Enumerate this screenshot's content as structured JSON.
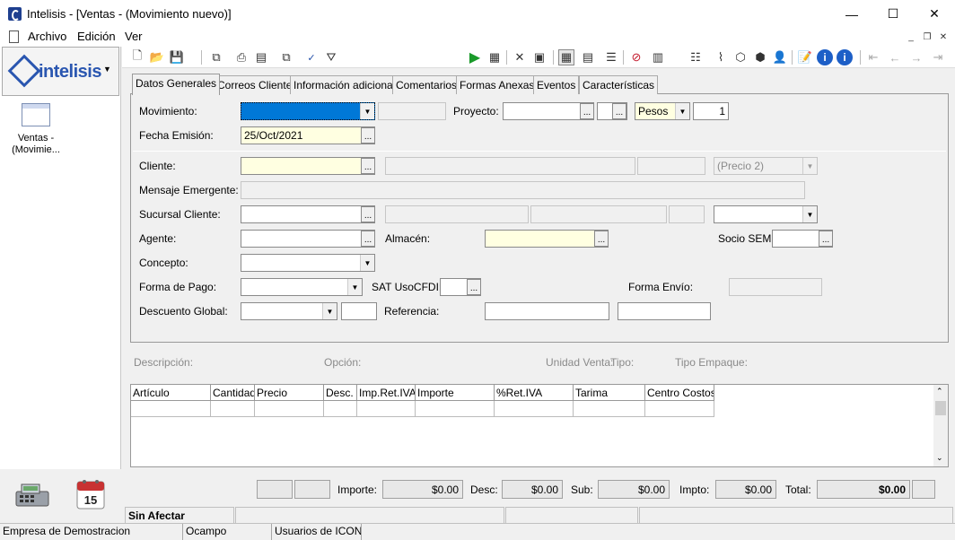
{
  "window": {
    "title": "Intelisis - [Ventas - (Movimiento nuevo)]",
    "minimize_glyph": "—",
    "maximize_glyph": "☐",
    "close_glyph": "✕"
  },
  "menu": {
    "items": [
      {
        "label": "Archivo"
      },
      {
        "label": "Edición"
      },
      {
        "label": "Ver"
      }
    ]
  },
  "nav": {
    "logo_text": "intelisis",
    "logo_arrow": "▼",
    "items": [
      {
        "label": "Ventas - (Movimie..."
      }
    ]
  },
  "toolbar": {
    "icons": [
      "new-icon",
      "open-icon",
      "save-icon",
      "copy-icon",
      "print-icon",
      "preview-icon",
      "duplicate-icon",
      "spellcheck-icon",
      "filter-icon",
      "run-icon",
      "calculator-icon",
      "cancel-icon",
      "report-icon",
      "grid-view-icon",
      "form-view-icon",
      "list-view-icon",
      "disable-icon",
      "barcode-icon",
      "list-icon",
      "attach-icon",
      "box-icon",
      "boxes-icon",
      "user-icon",
      "notes-icon",
      "info-icon",
      "info2-icon",
      "first-icon",
      "prev-icon",
      "next-icon",
      "last-icon"
    ]
  },
  "tabs": [
    {
      "label": "Datos Generales"
    },
    {
      "label": "Correos Cliente"
    },
    {
      "label": "Información adicional"
    },
    {
      "label": "Comentarios"
    },
    {
      "label": "Formas Anexas"
    },
    {
      "label": "Eventos"
    },
    {
      "label": "Características"
    }
  ],
  "form": {
    "movimiento_label": "Movimiento:",
    "movimiento_value": "",
    "proyecto_label": "Proyecto:",
    "moneda_value": "Pesos",
    "tipo_cambio_value": "1",
    "fecha_label": "Fecha Emisión:",
    "fecha_value": "25/Oct/2021",
    "cliente_label": "Cliente:",
    "precio_value": "(Precio 2)",
    "mensaje_label": "Mensaje Emergente:",
    "sucursal_label": "Sucursal Cliente:",
    "agente_label": "Agente:",
    "almacen_label": "Almacén:",
    "socio_label": "Socio SEM:",
    "concepto_label": "Concepto:",
    "forma_pago_label": "Forma de Pago:",
    "sat_label": "SAT UsoCFDI:",
    "forma_envio_label": "Forma Envío:",
    "descuento_label": "Descuento  Global:",
    "referencia_label": "Referencia:"
  },
  "details": {
    "descripcion": "Descripción:",
    "opcion": "Opción:",
    "unidad": "Unidad Venta:",
    "tipo": "Tipo:",
    "empaque": "Tipo Empaque:"
  },
  "grid": {
    "columns": [
      "Artículo",
      "Cantidad",
      "Precio",
      "Desc.",
      "Imp.Ret.IVA",
      "Importe",
      "%Ret.IVA",
      "Tarima",
      "Centro Costos"
    ]
  },
  "totals": {
    "importe_label": "Importe:",
    "importe_value": "$0.00",
    "desc_label": "Desc:",
    "desc_value": "$0.00",
    "sub_label": "Sub:",
    "sub_value": "$0.00",
    "impto_label": "Impto:",
    "impto_value": "$0.00",
    "total_label": "Total:",
    "total_value": "$0.00"
  },
  "status": {
    "estado": "Sin Afectar",
    "empresa": "Empresa de Demostracion",
    "sucursal": "Ocampo",
    "usuario": "Usuarios de ICON"
  }
}
